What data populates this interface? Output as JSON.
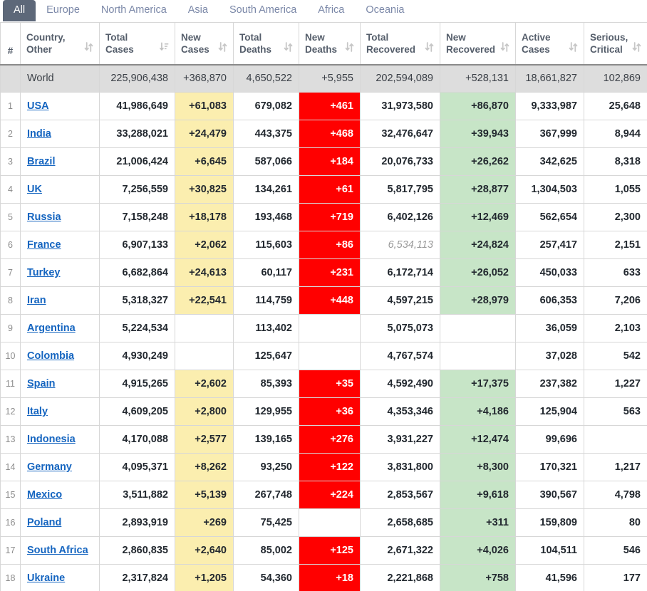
{
  "tabs": [
    {
      "label": "All",
      "active": true
    },
    {
      "label": "Europe",
      "active": false
    },
    {
      "label": "North America",
      "active": false
    },
    {
      "label": "Asia",
      "active": false
    },
    {
      "label": "South America",
      "active": false
    },
    {
      "label": "Africa",
      "active": false
    },
    {
      "label": "Oceania",
      "active": false
    }
  ],
  "columns": [
    {
      "label": "#",
      "sort": "none"
    },
    {
      "label": "Country,\nOther",
      "line1": "Country,",
      "line2": "Other",
      "sort": "updown"
    },
    {
      "label": "Total\nCases",
      "line1": "Total",
      "line2": "Cases",
      "sort": "desc-active"
    },
    {
      "label": "New\nCases",
      "line1": "New",
      "line2": "Cases",
      "sort": "updown"
    },
    {
      "label": "Total\nDeaths",
      "line1": "Total",
      "line2": "Deaths",
      "sort": "updown"
    },
    {
      "label": "New\nDeaths",
      "line1": "New",
      "line2": "Deaths",
      "sort": "updown"
    },
    {
      "label": "Total\nRecovered",
      "line1": "Total",
      "line2": "Recovered",
      "sort": "updown"
    },
    {
      "label": "New\nRecovered",
      "line1": "New",
      "line2": "Recovered",
      "sort": "updown"
    },
    {
      "label": "Active\nCases",
      "line1": "Active",
      "line2": "Cases",
      "sort": "updown"
    },
    {
      "label": "Serious,\nCritical",
      "line1": "Serious,",
      "line2": "Critical",
      "sort": "updown"
    }
  ],
  "colors": {
    "tab_active_bg": "#5d6879",
    "tab_text": "#7b88a8",
    "new_cases_bg": "#fbeeaf",
    "new_deaths_bg": "#ff0000",
    "new_recovered_bg": "#c7e5c7",
    "world_row_bg": "#dddddd",
    "country_link": "#1565c0"
  },
  "world_row": {
    "idx": "",
    "country": "World",
    "total_cases": "225,906,438",
    "new_cases": "+368,870",
    "total_deaths": "4,650,522",
    "new_deaths": "+5,955",
    "total_recovered": "202,594,089",
    "new_recovered": "+528,131",
    "active_cases": "18,661,827",
    "serious_critical": "102,869"
  },
  "rows": [
    {
      "idx": "1",
      "country": "USA",
      "total_cases": "41,986,649",
      "new_cases": "+61,083",
      "total_deaths": "679,082",
      "new_deaths": "+461",
      "total_recovered": "31,973,580",
      "new_recovered": "+86,870",
      "active_cases": "9,333,987",
      "serious_critical": "25,648"
    },
    {
      "idx": "2",
      "country": "India",
      "total_cases": "33,288,021",
      "new_cases": "+24,479",
      "total_deaths": "443,375",
      "new_deaths": "+468",
      "total_recovered": "32,476,647",
      "new_recovered": "+39,943",
      "active_cases": "367,999",
      "serious_critical": "8,944"
    },
    {
      "idx": "3",
      "country": "Brazil",
      "total_cases": "21,006,424",
      "new_cases": "+6,645",
      "total_deaths": "587,066",
      "new_deaths": "+184",
      "total_recovered": "20,076,733",
      "new_recovered": "+26,262",
      "active_cases": "342,625",
      "serious_critical": "8,318"
    },
    {
      "idx": "4",
      "country": "UK",
      "total_cases": "7,256,559",
      "new_cases": "+30,825",
      "total_deaths": "134,261",
      "new_deaths": "+61",
      "total_recovered": "5,817,795",
      "new_recovered": "+28,877",
      "active_cases": "1,304,503",
      "serious_critical": "1,055"
    },
    {
      "idx": "5",
      "country": "Russia",
      "total_cases": "7,158,248",
      "new_cases": "+18,178",
      "total_deaths": "193,468",
      "new_deaths": "+719",
      "total_recovered": "6,402,126",
      "new_recovered": "+12,469",
      "active_cases": "562,654",
      "serious_critical": "2,300"
    },
    {
      "idx": "6",
      "country": "France",
      "total_cases": "6,907,133",
      "new_cases": "+2,062",
      "total_deaths": "115,603",
      "new_deaths": "+86",
      "total_recovered": "6,534,113",
      "total_recovered_muted": true,
      "new_recovered": "+24,824",
      "active_cases": "257,417",
      "serious_critical": "2,151"
    },
    {
      "idx": "7",
      "country": "Turkey",
      "total_cases": "6,682,864",
      "new_cases": "+24,613",
      "total_deaths": "60,117",
      "new_deaths": "+231",
      "total_recovered": "6,172,714",
      "new_recovered": "+26,052",
      "active_cases": "450,033",
      "serious_critical": "633"
    },
    {
      "idx": "8",
      "country": "Iran",
      "total_cases": "5,318,327",
      "new_cases": "+22,541",
      "total_deaths": "114,759",
      "new_deaths": "+448",
      "total_recovered": "4,597,215",
      "new_recovered": "+28,979",
      "active_cases": "606,353",
      "serious_critical": "7,206"
    },
    {
      "idx": "9",
      "country": "Argentina",
      "total_cases": "5,224,534",
      "new_cases": "",
      "total_deaths": "113,402",
      "new_deaths": "",
      "total_recovered": "5,075,073",
      "new_recovered": "",
      "active_cases": "36,059",
      "serious_critical": "2,103"
    },
    {
      "idx": "10",
      "country": "Colombia",
      "total_cases": "4,930,249",
      "new_cases": "",
      "total_deaths": "125,647",
      "new_deaths": "",
      "total_recovered": "4,767,574",
      "new_recovered": "",
      "active_cases": "37,028",
      "serious_critical": "542"
    },
    {
      "idx": "11",
      "country": "Spain",
      "total_cases": "4,915,265",
      "new_cases": "+2,602",
      "total_deaths": "85,393",
      "new_deaths": "+35",
      "total_recovered": "4,592,490",
      "new_recovered": "+17,375",
      "active_cases": "237,382",
      "serious_critical": "1,227"
    },
    {
      "idx": "12",
      "country": "Italy",
      "total_cases": "4,609,205",
      "new_cases": "+2,800",
      "total_deaths": "129,955",
      "new_deaths": "+36",
      "total_recovered": "4,353,346",
      "new_recovered": "+4,186",
      "active_cases": "125,904",
      "serious_critical": "563"
    },
    {
      "idx": "13",
      "country": "Indonesia",
      "total_cases": "4,170,088",
      "new_cases": "+2,577",
      "total_deaths": "139,165",
      "new_deaths": "+276",
      "total_recovered": "3,931,227",
      "new_recovered": "+12,474",
      "active_cases": "99,696",
      "serious_critical": ""
    },
    {
      "idx": "14",
      "country": "Germany",
      "total_cases": "4,095,371",
      "new_cases": "+8,262",
      "total_deaths": "93,250",
      "new_deaths": "+122",
      "total_recovered": "3,831,800",
      "new_recovered": "+8,300",
      "active_cases": "170,321",
      "serious_critical": "1,217"
    },
    {
      "idx": "15",
      "country": "Mexico",
      "total_cases": "3,511,882",
      "new_cases": "+5,139",
      "total_deaths": "267,748",
      "new_deaths": "+224",
      "total_recovered": "2,853,567",
      "new_recovered": "+9,618",
      "active_cases": "390,567",
      "serious_critical": "4,798"
    },
    {
      "idx": "16",
      "country": "Poland",
      "total_cases": "2,893,919",
      "new_cases": "+269",
      "total_deaths": "75,425",
      "new_deaths": "",
      "total_recovered": "2,658,685",
      "new_recovered": "+311",
      "active_cases": "159,809",
      "serious_critical": "80"
    },
    {
      "idx": "17",
      "country": "South Africa",
      "total_cases": "2,860,835",
      "new_cases": "+2,640",
      "total_deaths": "85,002",
      "new_deaths": "+125",
      "total_recovered": "2,671,322",
      "new_recovered": "+4,026",
      "active_cases": "104,511",
      "serious_critical": "546"
    },
    {
      "idx": "18",
      "country": "Ukraine",
      "total_cases": "2,317,824",
      "new_cases": "+1,205",
      "total_deaths": "54,360",
      "new_deaths": "+18",
      "total_recovered": "2,221,868",
      "new_recovered": "+758",
      "active_cases": "41,596",
      "serious_critical": "177"
    }
  ]
}
